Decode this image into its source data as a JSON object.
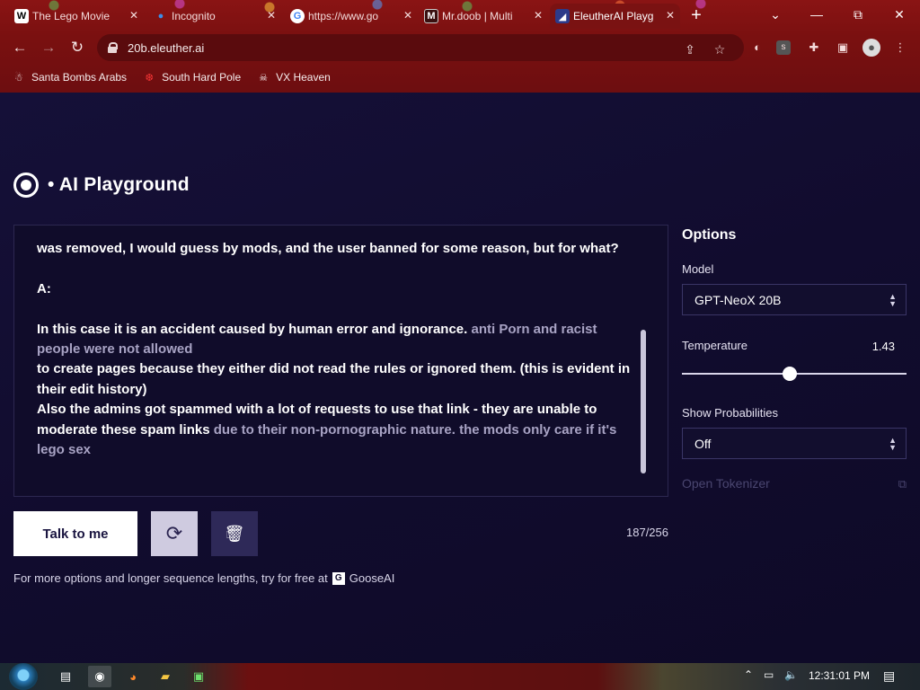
{
  "browser": {
    "tabs": [
      {
        "label": "The Lego Movie",
        "favicon": "W",
        "favicon_color": "#ffffff",
        "favicon_bg": "#ffffff"
      },
      {
        "label": "Incognito",
        "favicon": "●",
        "favicon_color": "#3b8ee8",
        "favicon_bg": "transparent"
      },
      {
        "label": "https://www.go",
        "favicon": "G",
        "favicon_color": "#4285f4",
        "favicon_bg": "#ffffff"
      },
      {
        "label": "Mr.doob | Multi",
        "favicon": "M",
        "favicon_color": "#ffffff",
        "favicon_bg": "#4a1a1a"
      },
      {
        "label": "EleutherAI Playg",
        "favicon": "◢",
        "favicon_color": "#ffffff",
        "favicon_bg": "#2c3a8a"
      }
    ],
    "new_tab": "+",
    "url": "20b.eleuther.ai",
    "window_controls": {
      "dropdown": "⌄",
      "minimize": "—",
      "restore": "⧉",
      "close": "✕"
    },
    "bookmarks": [
      {
        "label": "Santa Bombs Arabs",
        "icon": "☃"
      },
      {
        "label": "South Hard Pole",
        "icon": "❆"
      },
      {
        "label": "VX Heaven",
        "icon": "☠"
      }
    ]
  },
  "page": {
    "title": "• AI Playground",
    "editor": {
      "paragraphs": [
        {
          "prompt": "was removed, I would guess by mods, and the user banned for some reason, but for what?",
          "generated": ""
        },
        {
          "prompt": "A:",
          "generated": ""
        },
        {
          "prompt": "In this case it is an accident caused by human error and ignorance.",
          "generated": " anti Porn and racist people were not allowed"
        }
      ],
      "line4": "to create pages because they either did not read the rules or ignored them. (this is evident in their edit history)",
      "line5_prompt": "Also the admins got spammed with a lot of requests to use that link - they are unable to moderate these spam links",
      "line5_generated": " due to their non-pornographic nature. the mods only care if it's lego sex"
    },
    "buttons": {
      "talk": "Talk to me",
      "regenerate_icon": "⟳",
      "delete_icon": "🗑"
    },
    "token_count": "187/256",
    "footer": {
      "note": "For more options and longer sequence lengths, try for free at",
      "link": "GooseAI"
    },
    "options": {
      "title": "Options",
      "model_label": "Model",
      "model_value": "GPT-NeoX 20B",
      "temperature_label": "Temperature",
      "temperature_value": "1.43",
      "temperature_fraction": 0.48,
      "probabilities_label": "Show Probabilities",
      "probabilities_value": "Off",
      "tokenizer_link": "Open Tokenizer"
    }
  },
  "taskbar": {
    "clock": "12:31:01 PM",
    "icons": [
      "chrome-icon",
      "firefox-icon",
      "explorer-icon",
      "app-icon"
    ]
  },
  "colors": {
    "page_bg": "#110d2e",
    "chrome_bg": "#7a1010",
    "generated_text": "#a8a3c4"
  }
}
